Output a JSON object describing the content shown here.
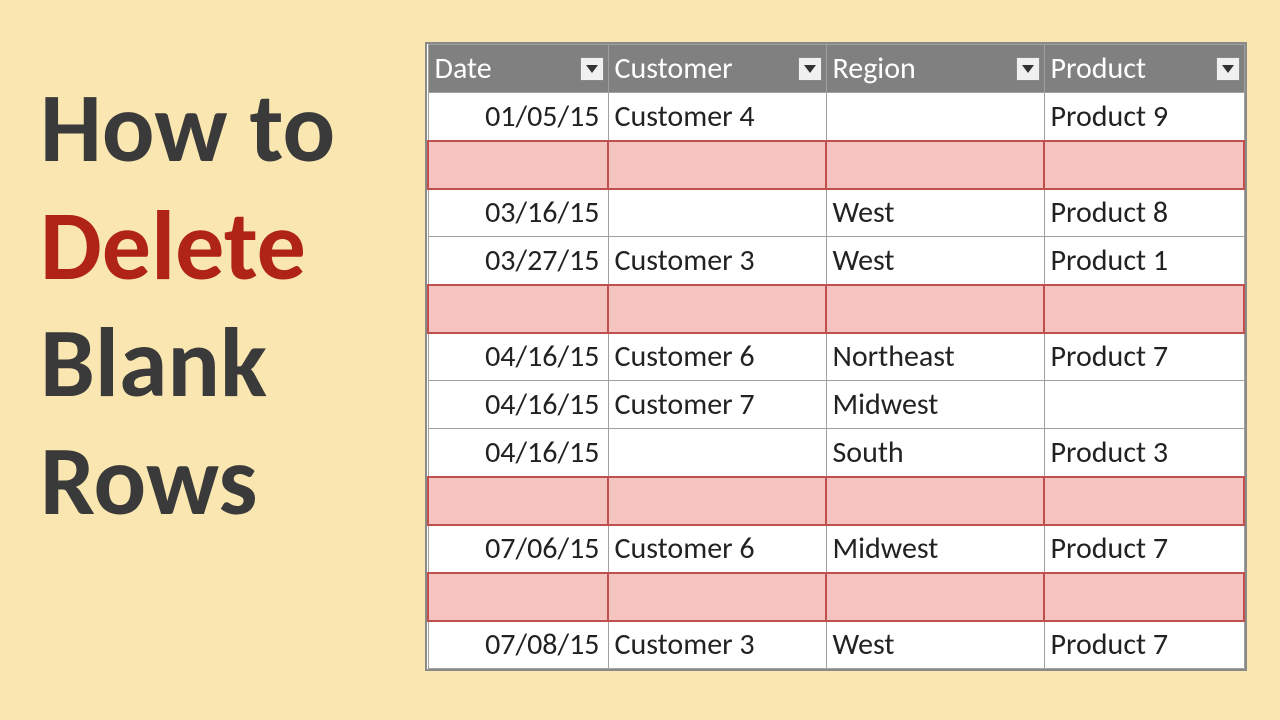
{
  "title": {
    "line1": "How to",
    "line2": "Delete",
    "line3": "Blank",
    "line4": "Rows"
  },
  "table": {
    "headers": {
      "date": "Date",
      "customer": "Customer",
      "region": "Region",
      "product": "Product"
    },
    "rows": [
      {
        "date": "01/05/15",
        "customer": "Customer 4",
        "region": "",
        "product": "Product 9",
        "highlight": false
      },
      {
        "date": "",
        "customer": "",
        "region": "",
        "product": "",
        "highlight": true
      },
      {
        "date": "03/16/15",
        "customer": "",
        "region": "West",
        "product": "Product 8",
        "highlight": false
      },
      {
        "date": "03/27/15",
        "customer": "Customer 3",
        "region": "West",
        "product": "Product 1",
        "highlight": false
      },
      {
        "date": "",
        "customer": "",
        "region": "",
        "product": "",
        "highlight": true
      },
      {
        "date": "04/16/15",
        "customer": "Customer 6",
        "region": "Northeast",
        "product": "Product 7",
        "highlight": false
      },
      {
        "date": "04/16/15",
        "customer": "Customer 7",
        "region": "Midwest",
        "product": "",
        "highlight": false
      },
      {
        "date": "04/16/15",
        "customer": "",
        "region": "South",
        "product": "Product 3",
        "highlight": false
      },
      {
        "date": "",
        "customer": "",
        "region": "",
        "product": "",
        "highlight": true
      },
      {
        "date": "07/06/15",
        "customer": "Customer 6",
        "region": "Midwest",
        "product": "Product 7",
        "highlight": false
      },
      {
        "date": "",
        "customer": "",
        "region": "",
        "product": "",
        "highlight": true
      },
      {
        "date": "07/08/15",
        "customer": "Customer 3",
        "region": "West",
        "product": "Product 7",
        "highlight": false
      }
    ]
  }
}
